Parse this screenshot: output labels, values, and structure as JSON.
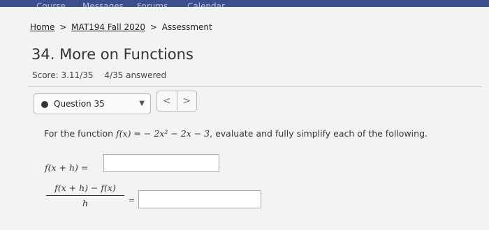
{
  "topnav": [
    "Course",
    "Messages",
    "Forums",
    "Calendar"
  ],
  "breadcrumb": {
    "home": "Home",
    "course": "MAT194 Fall 2020",
    "current": "Assessment",
    "separator": ">"
  },
  "page_title": "34. More on Functions",
  "score": {
    "score_text": "Score: 3.11/35",
    "answered_text": "4/35 answered"
  },
  "question_select": {
    "selected": "Question 35"
  },
  "nav_buttons": {
    "prev": "<",
    "next": ">"
  },
  "question": {
    "prompt_prefix": "For the function ",
    "function_expr": "f(x) = − 2x² − 2x − 3",
    "prompt_suffix": ", evaluate and fully simplify each of the following.",
    "part1_label": "f(x + h) =",
    "part2_numerator": "f(x + h) − f(x)",
    "part2_denominator": "h",
    "part2_equals": "="
  }
}
